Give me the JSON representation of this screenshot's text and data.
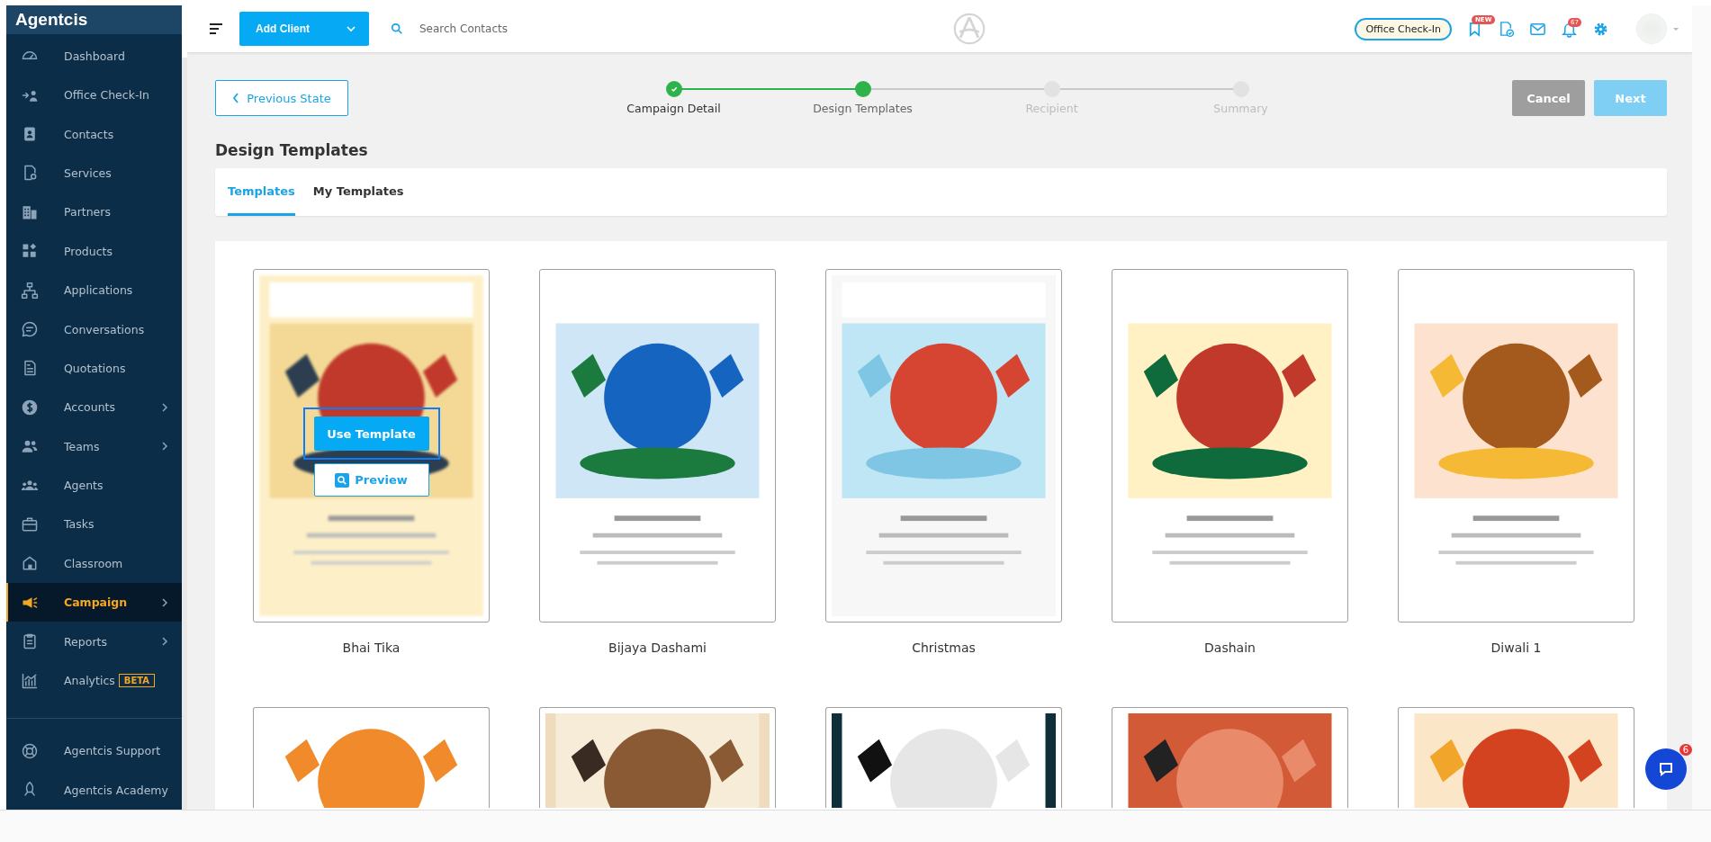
{
  "sidebar": {
    "brand": "Agentcis",
    "items": [
      {
        "label": "Dashboard",
        "selected": false,
        "expandable": false
      },
      {
        "label": "Office Check-In",
        "selected": false,
        "expandable": false
      },
      {
        "label": "Contacts",
        "selected": false,
        "expandable": false
      },
      {
        "label": "Services",
        "selected": false,
        "expandable": false
      },
      {
        "label": "Partners",
        "selected": false,
        "expandable": false
      },
      {
        "label": "Products",
        "selected": false,
        "expandable": false
      },
      {
        "label": "Applications",
        "selected": false,
        "expandable": false
      },
      {
        "label": "Conversations",
        "selected": false,
        "expandable": false
      },
      {
        "label": "Quotations",
        "selected": false,
        "expandable": false
      },
      {
        "label": "Accounts",
        "selected": false,
        "expandable": true
      },
      {
        "label": "Teams",
        "selected": false,
        "expandable": true
      },
      {
        "label": "Agents",
        "selected": false,
        "expandable": false
      },
      {
        "label": "Tasks",
        "selected": false,
        "expandable": false
      },
      {
        "label": "Classroom",
        "selected": false,
        "expandable": false
      },
      {
        "label": "Campaign",
        "selected": true,
        "expandable": true
      },
      {
        "label": "Reports",
        "selected": false,
        "expandable": true
      },
      {
        "label": "Analytics",
        "selected": false,
        "expandable": false,
        "badge": "BETA"
      }
    ],
    "footer_items": [
      {
        "label": "Agentcis Support"
      },
      {
        "label": "Agentcis Academy"
      }
    ]
  },
  "header": {
    "add_button": "Add Client",
    "search": {
      "placeholder": "Search Contacts"
    },
    "check_in_button": "Office Check-In",
    "new_badge": "NEW",
    "notification_count": "67"
  },
  "toolbar": {
    "back_button": "Previous State",
    "cancel_button": "Cancel",
    "next_button": "Next",
    "next_disabled": true
  },
  "steps": [
    {
      "label": "Campaign Detail",
      "completed": true,
      "selected": false
    },
    {
      "label": "Design Templates",
      "completed": false,
      "selected": true
    },
    {
      "label": "Recipient",
      "completed": false,
      "selected": false
    },
    {
      "label": "Summary",
      "completed": false,
      "selected": false
    }
  ],
  "section_title": "Design Templates",
  "tabs": [
    {
      "label": "Templates",
      "selected": true
    },
    {
      "label": "My Templates",
      "selected": false
    }
  ],
  "templates": [
    {
      "name": "Bhai Tika",
      "kind": "picture",
      "hovered": true,
      "use_button": "Use Template",
      "preview_button": "Preview"
    },
    {
      "name": "Bijaya Dashami",
      "kind": "picture",
      "hovered": false
    },
    {
      "name": "Christmas",
      "kind": "picture",
      "hovered": false
    },
    {
      "name": "Dashain",
      "kind": "picture",
      "hovered": false
    },
    {
      "name": "Diwali 1",
      "kind": "picture",
      "hovered": false
    },
    {
      "kind": "picture",
      "hovered": false
    },
    {
      "kind": "picture",
      "hovered": false
    },
    {
      "kind": "picture",
      "hovered": false
    },
    {
      "kind": "picture",
      "hovered": false
    },
    {
      "kind": "picture",
      "hovered": false
    }
  ],
  "chat": {
    "badge": "6"
  }
}
